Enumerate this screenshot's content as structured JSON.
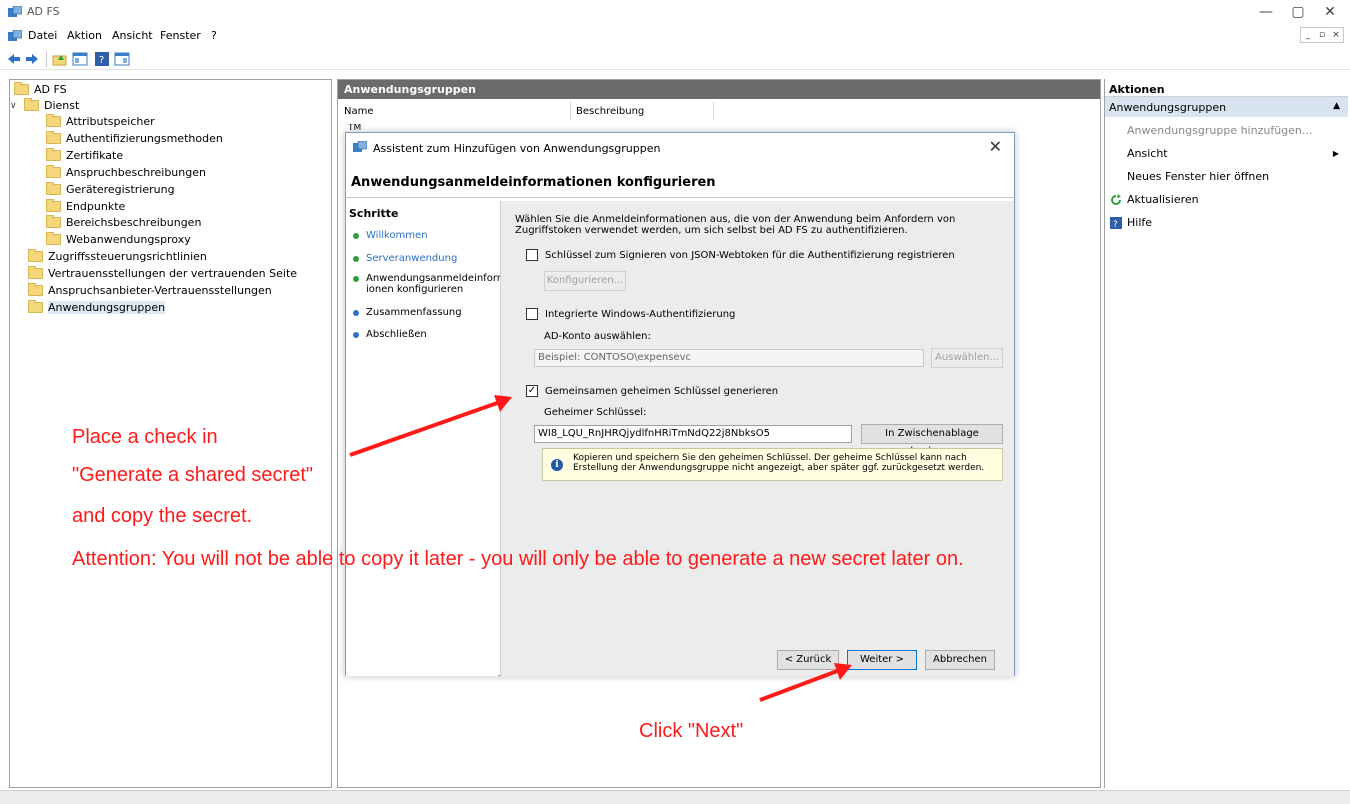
{
  "window": {
    "title": "AD FS",
    "controls": [
      "—",
      "▢",
      "✕"
    ]
  },
  "menu": {
    "items": [
      "Datei",
      "Aktion",
      "Ansicht",
      "Fenster",
      "?"
    ]
  },
  "tree": {
    "items": [
      {
        "label": "AD FS",
        "level": 0
      },
      {
        "label": "Dienst",
        "level": 0
      },
      {
        "label": "Attributspeicher",
        "level": 1
      },
      {
        "label": "Authentifizierungsmethoden",
        "level": 1
      },
      {
        "label": "Zertifikate",
        "level": 1
      },
      {
        "label": "Anspruchbeschreibungen",
        "level": 1
      },
      {
        "label": "Geräteregistrierung",
        "level": 1
      },
      {
        "label": "Endpunkte",
        "level": 1
      },
      {
        "label": "Bereichsbeschreibungen",
        "level": 1
      },
      {
        "label": "Webanwendungsproxy",
        "level": 1
      },
      {
        "label": "Zugriffssteuerungsrichtlinien",
        "level": 0
      },
      {
        "label": "Vertrauensstellungen der vertrauenden Seite",
        "level": 0
      },
      {
        "label": "Anspruchsanbieter-Vertrauensstellungen",
        "level": 0
      },
      {
        "label": "Anwendungsgruppen",
        "level": 0
      }
    ]
  },
  "center": {
    "header": "Anwendungsgruppen",
    "columns": [
      "Name",
      "Beschreibung"
    ],
    "row_partial": "TM"
  },
  "actions": {
    "title": "Aktionen",
    "section": "Anwendungsgruppen",
    "items": [
      {
        "label": "Anwendungsgruppe hinzufügen...",
        "icon": "none",
        "disabled": true
      },
      {
        "label": "Ansicht",
        "icon": "none",
        "submenu": true
      },
      {
        "label": "Neues Fenster hier öffnen",
        "icon": "none"
      },
      {
        "label": "Aktualisieren",
        "icon": "refresh-icon"
      },
      {
        "label": "Hilfe",
        "icon": "help-icon"
      }
    ]
  },
  "dialog": {
    "title": "Assistent zum Hinzufügen von Anwendungsgruppen",
    "close": "✕",
    "heading": "Anwendungsanmeldeinformationen konfigurieren",
    "steps_title": "Schritte",
    "steps": [
      {
        "label": "Willkommen",
        "color": "#2e9e3e",
        "link": true
      },
      {
        "label": "Serveranwendung",
        "color": "#2e9e3e",
        "link": true
      },
      {
        "label": "Anwendungsanmeldeinformat ionen konfigurieren",
        "color": "#2e9e3e",
        "link": false
      },
      {
        "label": "Zusammenfassung",
        "color": "#2f6fc9",
        "link": false
      },
      {
        "label": "Abschließen",
        "color": "#2f6fc9",
        "link": false
      }
    ],
    "intro": "Wählen Sie die Anmeldeinformationen aus, die von der Anwendung beim Anfordern von Zugriffstoken verwendet werden, um sich selbst bei AD FS zu authentifizieren.",
    "jwt_checkbox": "Schlüssel zum Signieren von JSON-Webtoken für die Authentifizierung registrieren",
    "configure_button": "Konfigurieren...",
    "windows_auth_checkbox": "Integrierte Windows-Authentifizierung",
    "ad_account_label": "AD-Konto auswählen:",
    "ad_account_placeholder": "Beispiel: CONTOSO\\expensevc",
    "select_button": "Auswählen...",
    "shared_secret_checkbox": "Gemeinsamen geheimen Schlüssel generieren",
    "shared_secret_checked": "✓",
    "secret_label": "Geheimer Schlüssel:",
    "secret_value": "WI8_LQU_RnJHRQjydlfnHRiTmNdQ22j8NbksO5",
    "copy_button": "In Zwischenablage kopieren",
    "info_icon": "i",
    "info_text": "Kopieren und speichern Sie den geheimen Schlüssel. Der geheime Schlüssel kann nach Erstellung der Anwendungsgruppe nicht angezeigt, aber später ggf. zurückgesetzt werden.",
    "back_button": "< Zurück",
    "next_button": "Weiter >",
    "cancel_button": "Abbrechen"
  },
  "annotations": {
    "line1": "Place a check in",
    "line2": "\"Generate a shared secret\"",
    "line3": "and copy the secret.",
    "line4": "Attention: You will not be able to copy it later - you will only be able to generate a new secret later on.",
    "next_hint": "Click \"Next\"",
    "color": "#ff1a1a"
  }
}
